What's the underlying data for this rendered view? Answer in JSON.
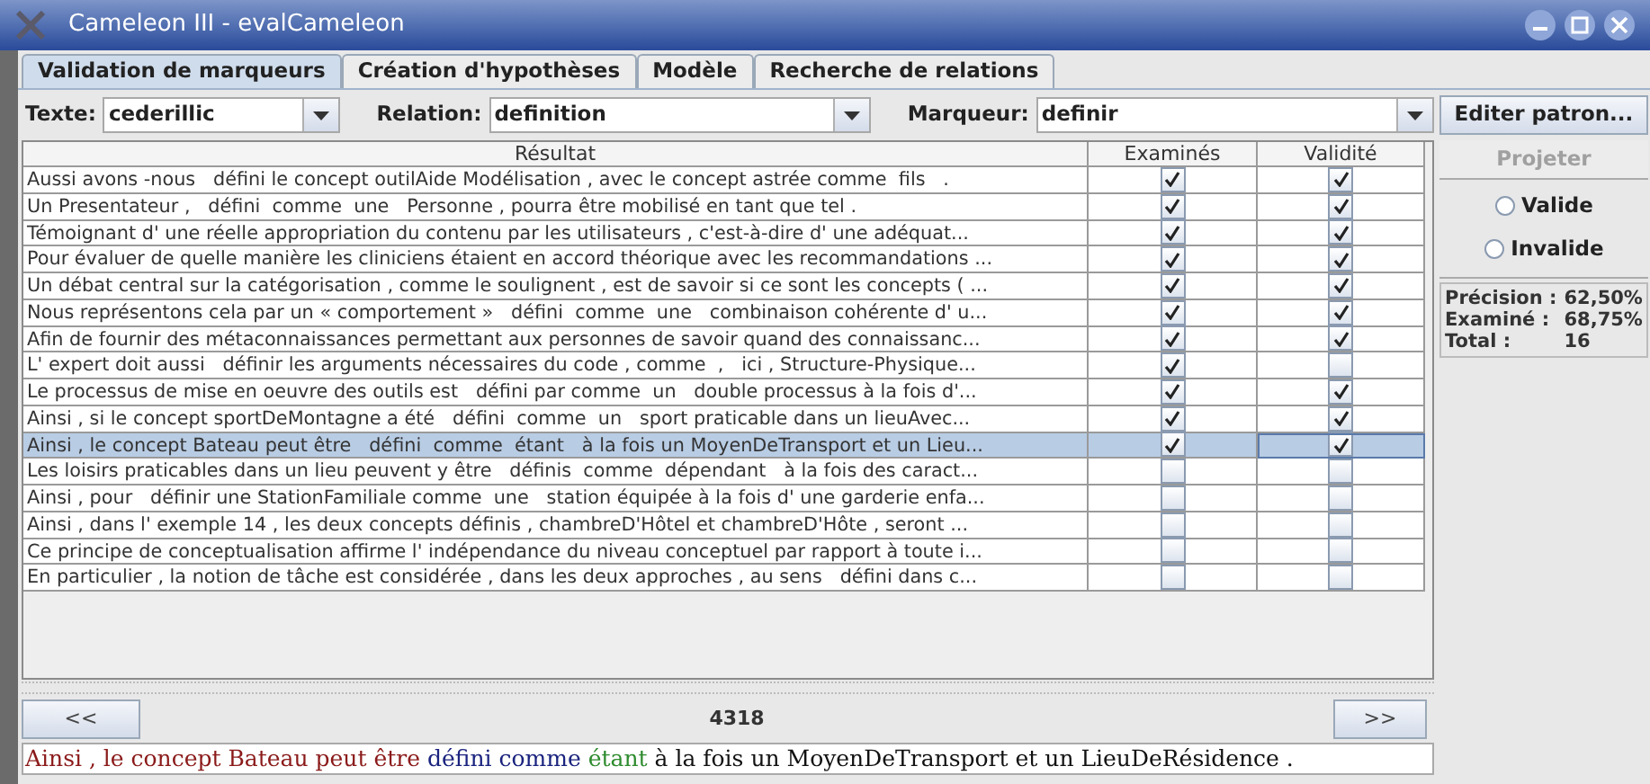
{
  "window": {
    "title": "Cameleon III - evalCameleon"
  },
  "tabs": [
    {
      "label": "Validation de marqueurs",
      "selected": true
    },
    {
      "label": "Création d'hypothèses",
      "selected": false
    },
    {
      "label": "Modèle",
      "selected": false
    },
    {
      "label": "Recherche de relations",
      "selected": false
    }
  ],
  "filters": [
    {
      "label": "Texte:",
      "value": "cederillic"
    },
    {
      "label": "Relation:",
      "value": "definition"
    },
    {
      "label": "Marqueur:",
      "value": "definir"
    }
  ],
  "table": {
    "columns": [
      "Résultat",
      "Examinés",
      "Validité"
    ],
    "rows": [
      {
        "text": "Aussi avons -nous   défini le concept outilAide Modélisation , avec le concept astrée comme  fils   .",
        "examined": true,
        "valid": true,
        "selected": false
      },
      {
        "text": "Un Presentateur ,   défini  comme  une   Personne , pourra être mobilisé en tant que tel .",
        "examined": true,
        "valid": true,
        "selected": false
      },
      {
        "text": "Témoignant d' une réelle appropriation du contenu par les utilisateurs , c'est-à-dire d' une adéquat...",
        "examined": true,
        "valid": true,
        "selected": false
      },
      {
        "text": "Pour évaluer de quelle manière les cliniciens étaient en accord théorique avec les recommandations ...",
        "examined": true,
        "valid": true,
        "selected": false
      },
      {
        "text": "Un débat central sur la catégorisation , comme le soulignent , est de savoir si ce sont les concepts ( ...",
        "examined": true,
        "valid": true,
        "selected": false
      },
      {
        "text": "Nous représentons cela par un « comportement »   défini  comme  une   combinaison cohérente d' u...",
        "examined": true,
        "valid": true,
        "selected": false
      },
      {
        "text": "Afin de fournir des métaconnaissances permettant aux personnes de savoir quand des connaissanc...",
        "examined": true,
        "valid": true,
        "selected": false
      },
      {
        "text": "L' expert doit aussi   définir les arguments nécessaires du code , comme  ,   ici , Structure-Physique...",
        "examined": true,
        "valid": false,
        "selected": false
      },
      {
        "text": "Le processus de mise en oeuvre des outils est   défini par comme  un   double processus à la fois d'...",
        "examined": true,
        "valid": true,
        "selected": false
      },
      {
        "text": "Ainsi , si le concept sportDeMontagne a été   défini  comme  un   sport praticable dans un lieuAvec...",
        "examined": true,
        "valid": true,
        "selected": false
      },
      {
        "text": "Ainsi , le concept Bateau peut être   défini  comme  étant   à la fois un MoyenDeTransport et un Lieu...",
        "examined": true,
        "valid": true,
        "selected": true
      },
      {
        "text": "Les loisirs praticables dans un lieu peuvent y être   définis  comme  dépendant   à la fois des caract...",
        "examined": false,
        "valid": false,
        "selected": false
      },
      {
        "text": "Ainsi , pour   définir une StationFamiliale comme  une   station équipée à la fois d' une garderie enfa...",
        "examined": false,
        "valid": false,
        "selected": false
      },
      {
        "text": "Ainsi , dans l' exemple 14 , les deux concepts définis , chambreD'Hôtel et chambreD'Hôte , seront ...",
        "examined": false,
        "valid": false,
        "selected": false
      },
      {
        "text": "Ce principe de conceptualisation affirme l' indépendance du niveau conceptuel par rapport à toute i...",
        "examined": false,
        "valid": false,
        "selected": false
      },
      {
        "text": "En particulier , la notion de tâche est considérée , dans les deux approches , au sens   défini dans c...",
        "examined": false,
        "valid": false,
        "selected": false
      }
    ]
  },
  "side": {
    "edit_button": "Editer patron...",
    "project_button": {
      "label": "Projeter",
      "disabled": true
    },
    "radios": [
      {
        "label": "Valide",
        "selected": false
      },
      {
        "label": "Invalide",
        "selected": false
      }
    ],
    "stats": [
      {
        "label": "Précision :",
        "value": "62,50%"
      },
      {
        "label": "Examiné :",
        "value": "68,75%"
      },
      {
        "label": "Total :",
        "value": "16"
      }
    ]
  },
  "nav": {
    "prev": "<<",
    "count": "4318",
    "next": ">>"
  },
  "sentence": [
    {
      "text": "Ainsi , le concept Bateau peut être",
      "color": "#8b1a1a"
    },
    {
      "text": "défini comme",
      "color": "#1a237e"
    },
    {
      "text": "étant",
      "color": "#2e8b2e"
    },
    {
      "text": "à la fois un MoyenDeTransport et un LieuDeRésidence .",
      "color": "#111111"
    }
  ]
}
